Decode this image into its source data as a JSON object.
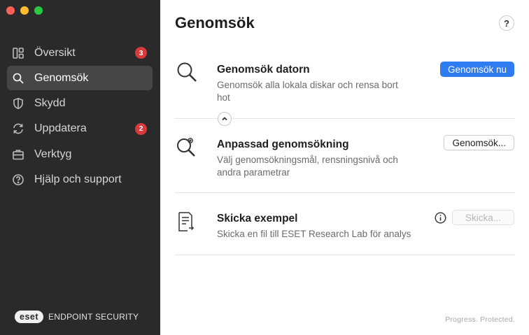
{
  "sidebar": {
    "items": [
      {
        "label": "Översikt",
        "icon": "dashboard-icon",
        "badge": "3",
        "active": false
      },
      {
        "label": "Genomsök",
        "icon": "search-icon",
        "badge": null,
        "active": true
      },
      {
        "label": "Skydd",
        "icon": "shield-icon",
        "badge": null,
        "active": false
      },
      {
        "label": "Uppdatera",
        "icon": "refresh-icon",
        "badge": "2",
        "active": false
      },
      {
        "label": "Verktyg",
        "icon": "briefcase-icon",
        "badge": null,
        "active": false
      },
      {
        "label": "Hjälp och support",
        "icon": "help-circle-icon",
        "badge": null,
        "active": false
      }
    ],
    "brand": {
      "logo": "eset",
      "product": "ENDPOINT SECURITY"
    }
  },
  "main": {
    "title": "Genomsök",
    "help_label": "?",
    "sections": [
      {
        "title": "Genomsök datorn",
        "description": "Genomsök alla lokala diskar och rensa bort hot",
        "button": "Genomsök nu",
        "icon": "magnifier-icon"
      },
      {
        "title": "Anpassad genomsökning",
        "description": "Välj genomsökningsmål, rensningsnivå och andra parametrar",
        "button": "Genomsök...",
        "icon": "magnifier-gear-icon"
      },
      {
        "title": "Skicka exempel",
        "description": "Skicka en fil till ESET Research Lab för analys",
        "button": "Skicka...",
        "icon": "document-send-icon"
      }
    ],
    "slogan": "Progress. Protected."
  },
  "colors": {
    "sidebar_bg": "#2a2a2a",
    "active_item_bg": "#464646",
    "badge": "#d83a3a",
    "primary": "#2f7bf0"
  }
}
